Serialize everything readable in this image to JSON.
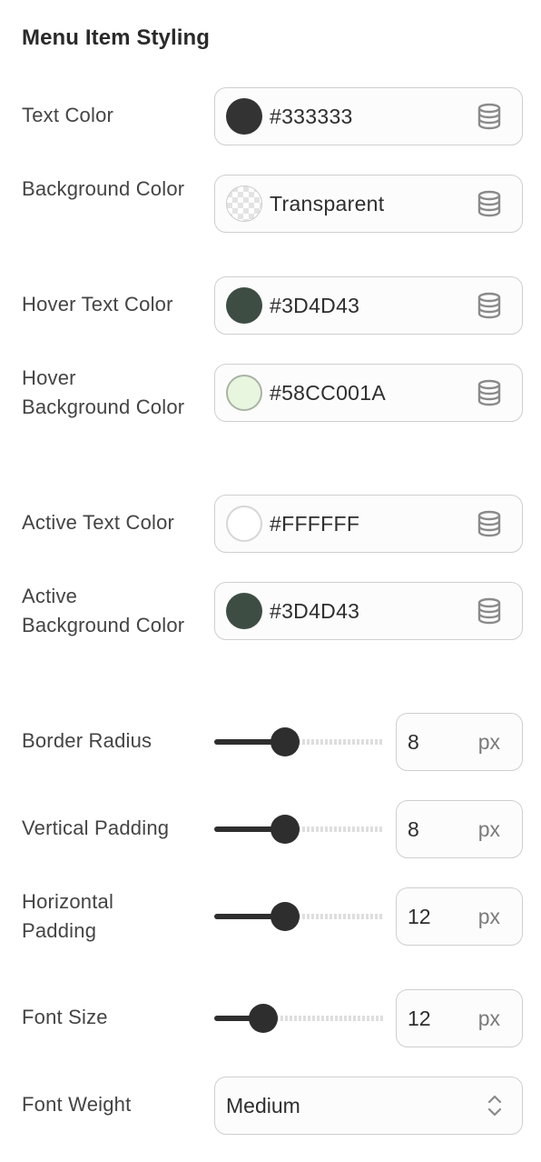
{
  "section": {
    "title": "Menu Item Styling"
  },
  "colors": [
    {
      "label": "Text Color",
      "value": "#333333",
      "swatch": "#333333"
    },
    {
      "label": "Background Color",
      "value": "Transparent",
      "swatch": "transparent"
    },
    {
      "label": "Hover Text Color",
      "value": "#3D4D43",
      "swatch": "#3D4D43"
    },
    {
      "label": "Hover Background Color",
      "value": "#58CC001A",
      "swatch": "#58CC001A"
    },
    {
      "label": "Active Text Color",
      "value": "#FFFFFF",
      "swatch": "#FFFFFF"
    },
    {
      "label": "Active Background Color",
      "value": "#3D4D43",
      "swatch": "#3D4D43"
    }
  ],
  "sliders": [
    {
      "label": "Border Radius",
      "value": "8",
      "unit": "px",
      "fill_fraction": 0.42
    },
    {
      "label": "Vertical Padding",
      "value": "8",
      "unit": "px",
      "fill_fraction": 0.42
    },
    {
      "label": "Horizontal Padding",
      "value": "12",
      "unit": "px",
      "fill_fraction": 0.42
    },
    {
      "label": "Font Size",
      "value": "12",
      "unit": "px",
      "fill_fraction": 0.29
    }
  ],
  "font_weight": {
    "label": "Font Weight",
    "value": "Medium"
  },
  "icons": {
    "color_source": "database-icon",
    "select_arrows": "chevron-up-down-icon"
  }
}
